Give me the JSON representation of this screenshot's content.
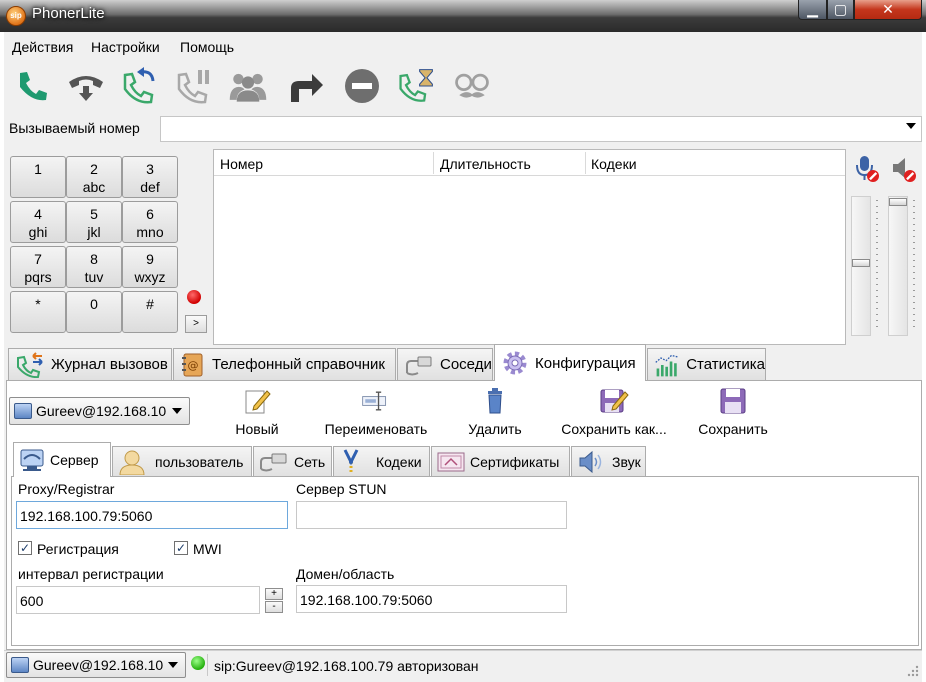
{
  "window": {
    "title": "PhonerLite"
  },
  "menu": [
    "Действия",
    "Настройки",
    "Помощь"
  ],
  "called": {
    "label": "Вызываемый номер",
    "value": ""
  },
  "keypad": [
    {
      "digit": "1",
      "letters": ""
    },
    {
      "digit": "2",
      "letters": "abc"
    },
    {
      "digit": "3",
      "letters": "def"
    },
    {
      "digit": "4",
      "letters": "ghi"
    },
    {
      "digit": "5",
      "letters": "jkl"
    },
    {
      "digit": "6",
      "letters": "mno"
    },
    {
      "digit": "7",
      "letters": "pqrs"
    },
    {
      "digit": "8",
      "letters": "tuv"
    },
    {
      "digit": "9",
      "letters": "wxyz"
    },
    {
      "digit": "*",
      "letters": ""
    },
    {
      "digit": "0",
      "letters": ""
    },
    {
      "digit": "#",
      "letters": ""
    }
  ],
  "keypad_more": ">",
  "calls": {
    "columns": [
      "Номер",
      "Длительность",
      "Кодеки"
    ],
    "rows": []
  },
  "main_tabs": [
    {
      "label": "Журнал вызовов",
      "icon": "call-log-icon"
    },
    {
      "label": "Телефонный справочник",
      "icon": "phonebook-icon"
    },
    {
      "label": "Соседи",
      "icon": "neighbors-icon"
    },
    {
      "label": "Конфигурация",
      "icon": "gear-icon",
      "active": true
    },
    {
      "label": "Статистика",
      "icon": "statistics-icon"
    }
  ],
  "profile": {
    "value": "Gureev@192.168.10"
  },
  "actions": [
    {
      "label": "Новый",
      "icon": "new-icon"
    },
    {
      "label": "Переименовать",
      "icon": "rename-icon"
    },
    {
      "label": "Удалить",
      "icon": "trash-icon"
    },
    {
      "label": "Сохранить как...",
      "icon": "save-as-icon"
    },
    {
      "label": "Сохранить",
      "icon": "save-icon"
    }
  ],
  "sub_tabs": [
    {
      "label": "Сервер",
      "icon": "server-icon",
      "active": true
    },
    {
      "label": "пользователь",
      "icon": "user-icon"
    },
    {
      "label": "Сеть",
      "icon": "network-icon"
    },
    {
      "label": "Кодеки",
      "icon": "codecs-icon"
    },
    {
      "label": "Сертификаты",
      "icon": "certificate-icon"
    },
    {
      "label": "Звук",
      "icon": "speaker-icon"
    }
  ],
  "server": {
    "proxy_label": "Proxy/Registrar",
    "proxy_value": "192.168.100.79:5060",
    "stun_label": "Сервер STUN",
    "stun_value": "",
    "registration_label": "Регистрация",
    "registration_checked": true,
    "mwi_label": "MWI",
    "mwi_checked": true,
    "interval_label": "интервал регистрации",
    "interval_value": "600",
    "domain_label": "Домен/область",
    "domain_value": "192.168.100.79:5060",
    "spin_up": "+",
    "spin_down": "-"
  },
  "status": {
    "profile": "Gureev@192.168.10",
    "text": "sip:Gureev@192.168.100.79 авторизован",
    "color": "#25b00e"
  }
}
